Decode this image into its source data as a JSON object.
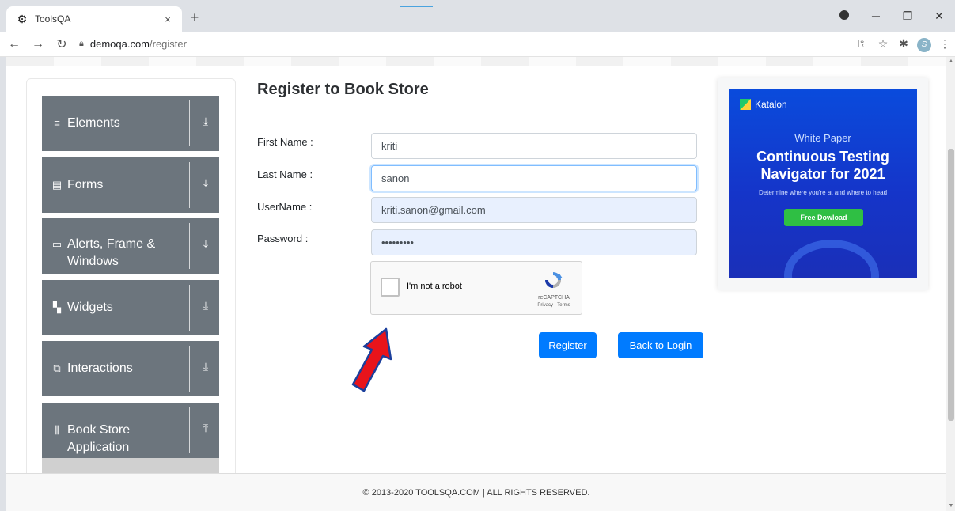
{
  "browser": {
    "tab_title": "ToolsQA",
    "tab_close": "×",
    "new_tab": "+",
    "url_host": "demoqa.com",
    "url_path": "/register",
    "profile_initial": "S"
  },
  "sidebar": {
    "groups": [
      {
        "label": "Elements",
        "icon": "hamburger-icon",
        "glyph": "≡",
        "chevron": "⤓"
      },
      {
        "label": "Forms",
        "icon": "document-icon",
        "glyph": "▤",
        "chevron": "⤓"
      },
      {
        "label": "Alerts, Frame &",
        "label2": "Windows",
        "icon": "window-icon",
        "glyph": "▭",
        "chevron": "⤓"
      },
      {
        "label": "Widgets",
        "icon": "widgets-icon",
        "glyph": "▚",
        "chevron": "⤓"
      },
      {
        "label": "Interactions",
        "icon": "interactions-icon",
        "glyph": "⧉",
        "chevron": "⤓"
      },
      {
        "label": "Book Store",
        "label2": "Application",
        "icon": "books-icon",
        "glyph": "⫼",
        "chevron": "⤒"
      }
    ]
  },
  "form": {
    "title": "Register to Book Store",
    "fields": [
      {
        "label": "First Name :",
        "value": "kriti"
      },
      {
        "label": "Last Name :",
        "value": "sanon"
      },
      {
        "label": "UserName :",
        "value": "kriti.sanon@gmail.com"
      },
      {
        "label": "Password :",
        "value": "•••••••••"
      }
    ],
    "captcha": {
      "label": "I'm not a robot",
      "brand": "reCAPTCHA",
      "links": "Privacy - Terms"
    },
    "register_label": "Register",
    "back_label": "Back to Login"
  },
  "ad": {
    "brand": "Katalon",
    "kicker": "White Paper",
    "headline_1": "Continuous Testing",
    "headline_2": "Navigator for 2021",
    "subline": "Determine where you're at and where to head",
    "cta": "Free Dowload"
  },
  "footer": {
    "text": "© 2013-2020 TOOLSQA.COM | ALL RIGHTS RESERVED."
  },
  "colors": {
    "sidebar_group": "#6c757d",
    "primary_button": "#007bff",
    "arrow": "#e8141b",
    "ad_bg": "#0a4bdc"
  }
}
